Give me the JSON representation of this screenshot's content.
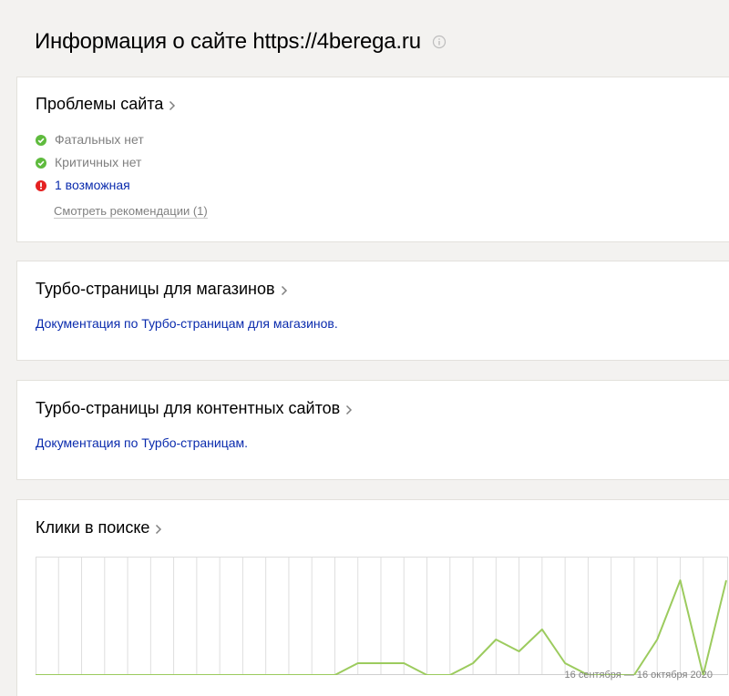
{
  "header": {
    "title": "Информация о сайте https://4berega.ru"
  },
  "problems": {
    "title": "Проблемы сайта",
    "items": [
      {
        "status": "ok",
        "icon": "check-circle-icon",
        "text": "Фатальных нет"
      },
      {
        "status": "ok",
        "icon": "check-circle-icon",
        "text": "Критичных нет"
      },
      {
        "status": "warning",
        "icon": "exclamation-circle-icon",
        "text": "1 возможная"
      }
    ],
    "recommendations_link": "Смотреть рекомендации (1)"
  },
  "turbo_shops": {
    "title": "Турбо-страницы для магазинов",
    "doc_link": "Документация по Турбо-страницам для магазинов."
  },
  "turbo_content": {
    "title": "Турбо-страницы для контентных сайтов",
    "doc_link": "Документация по Турбо-страницам."
  },
  "clicks": {
    "title": "Клики в поиске",
    "date_range": "16 сентября — 16 октября 2020"
  },
  "colors": {
    "ok": "#5fbb3e",
    "warning": "#e52121",
    "link": "#0a2bad",
    "chart_line": "#9ccb5e",
    "grid": "#dedede"
  },
  "chart_data": {
    "type": "line",
    "title": "",
    "xlabel": "",
    "ylabel": "",
    "x": [
      1,
      2,
      3,
      4,
      5,
      6,
      7,
      8,
      9,
      10,
      11,
      12,
      13,
      14,
      15,
      16,
      17,
      18,
      19,
      20,
      21,
      22,
      23,
      24,
      25,
      26,
      27,
      28,
      29,
      30,
      31
    ],
    "series": [
      {
        "values": [
          0,
          0,
          0,
          0,
          0,
          0,
          0,
          0,
          0,
          0,
          0,
          0,
          0,
          0,
          0.7,
          0.7,
          0.7,
          0,
          0,
          0.7,
          2.1,
          1.4,
          2.7,
          0.7,
          0,
          0,
          0,
          2.1,
          5.6,
          0,
          5.6
        ]
      }
    ],
    "ylim": [
      0,
      7
    ],
    "grid": true,
    "legend": "none"
  }
}
